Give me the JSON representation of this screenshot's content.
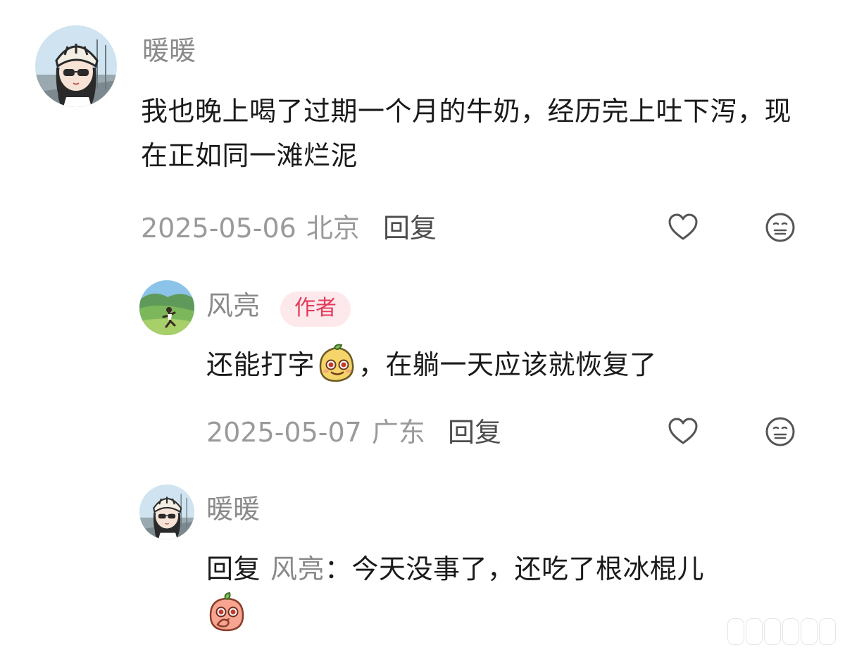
{
  "comments": [
    {
      "username": "暖暖",
      "text": "我也晚上喝了过期一个月的牛奶，经历完上吐下泻，现在正如同一滩烂泥",
      "date": "2025-05-06",
      "location": "北京",
      "reply_label": "回复",
      "avatar_icon": "avatar-girl-helmet",
      "like_icon": "heart-outline-icon",
      "dislike_icon": "meh-face-icon"
    },
    {
      "username": "风亮",
      "badge": "作者",
      "text_before_emoji": "还能打字",
      "text_after_emoji": "，在躺一天应该就恢复了",
      "date": "2025-05-07",
      "location": "广东",
      "reply_label": "回复",
      "avatar_icon": "avatar-landscape-runner",
      "emoji_icon": "smug-mango-emoji",
      "like_icon": "heart-outline-icon",
      "dislike_icon": "meh-face-icon"
    },
    {
      "username": "暖暖",
      "reply_prefix": "回复",
      "reply_to": "风亮",
      "text": "：今天没事了，还吃了根冰棍儿",
      "avatar_icon": "avatar-girl-helmet",
      "emoji_icon": "peach-thinking-emoji"
    }
  ],
  "colors": {
    "username": "#8a8a8a",
    "text": "#1a1a1a",
    "meta": "#9a9a9a",
    "badge_bg": "#fde8ec",
    "badge_text": "#e23b5a"
  }
}
